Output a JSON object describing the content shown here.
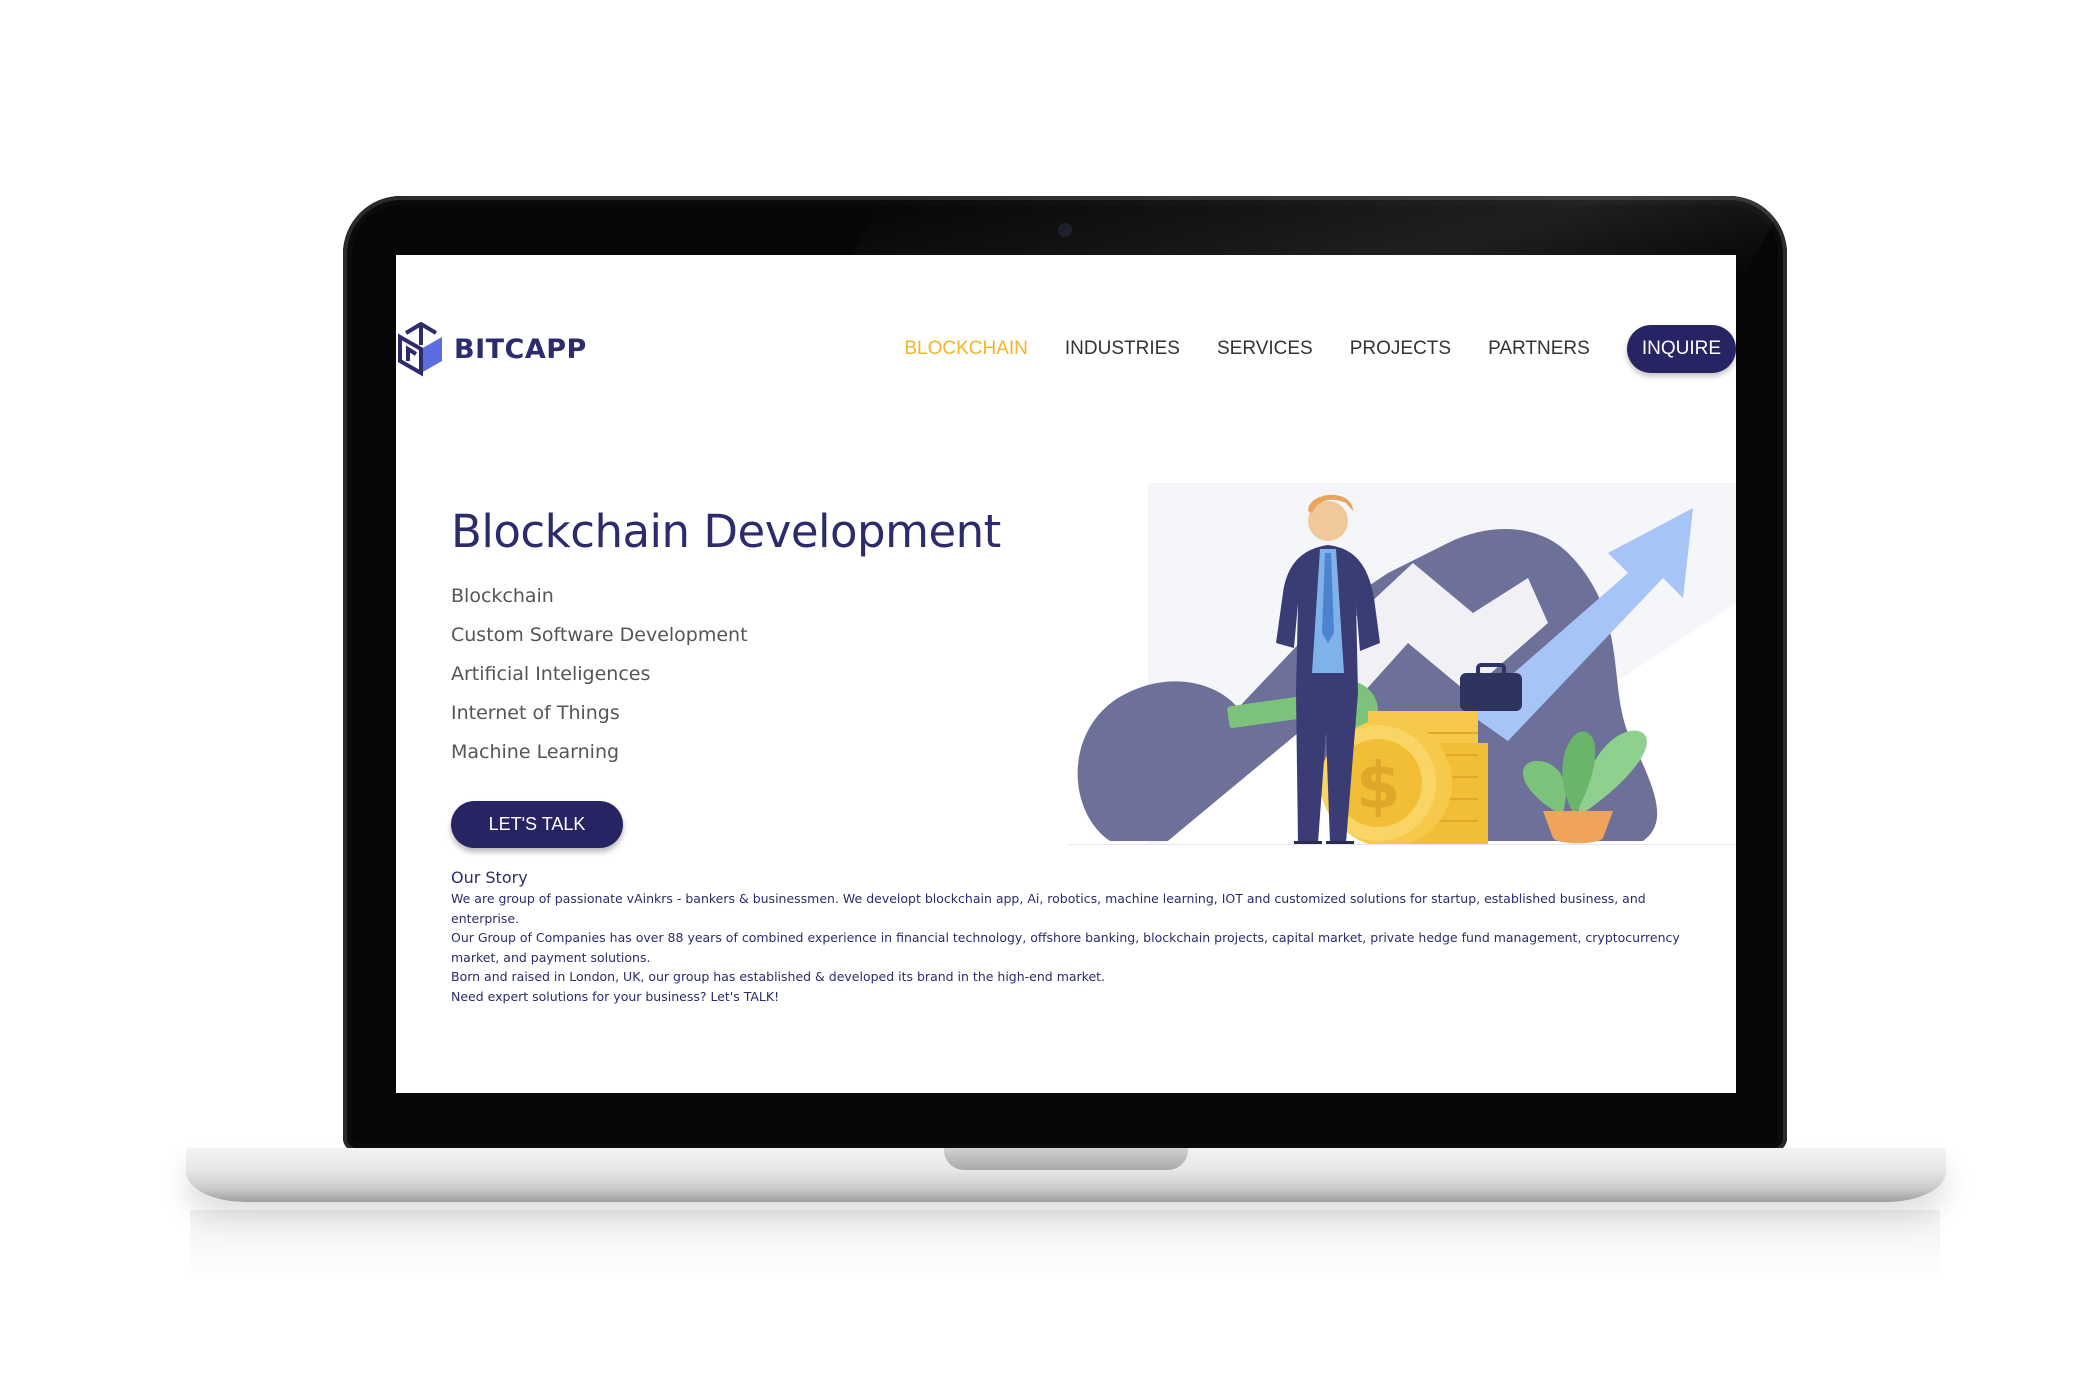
{
  "brand": {
    "name": "BITCAPP"
  },
  "nav": {
    "items": [
      {
        "label": "BLOCKCHAIN",
        "active": true
      },
      {
        "label": "INDUSTRIES",
        "active": false
      },
      {
        "label": "SERVICES",
        "active": false
      },
      {
        "label": "PROJECTS",
        "active": false
      },
      {
        "label": "PARTNERS",
        "active": false
      }
    ],
    "inquire_label": "INQUIRE"
  },
  "hero": {
    "title": "Blockchain Development",
    "services": [
      "Blockchain",
      "Custom Software Development",
      "Artificial Inteligences",
      "Internet of Things",
      "Machine Learning"
    ],
    "cta_label": "LET'S TALK"
  },
  "story": {
    "title": "Our Story",
    "paragraphs": [
      "We are group of passionate vAinkrs - bankers & businessmen. We developt blockchain app, Ai, robotics, machine learning, IOT and customized solutions for startup, established business, and enterprise.",
      "Our Group of Companies has over 88 years of combined experience in financial technology, offshore banking, blockchain projects, capital market, private hedge fund management, cryptocurrency market, and payment solutions.",
      "Born and raised in London, UK, our group has established & developed its brand in the high-end market.",
      "Need expert solutions for your business? Let's TALK!"
    ]
  },
  "colors": {
    "brand_navy": "#262463",
    "accent_gold": "#f2b52a",
    "illustration_purple": "#6d7099",
    "arrow_blue": "#a6c4f5"
  },
  "icons": {
    "logo": "cube-logo-icon",
    "illustration": "businessman-coins-growth-illustration"
  }
}
